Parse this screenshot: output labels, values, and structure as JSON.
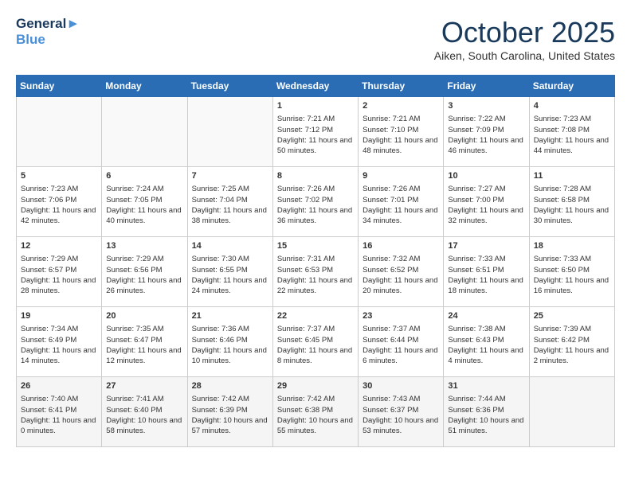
{
  "logo": {
    "line1": "General",
    "line2": "Blue"
  },
  "title": "October 2025",
  "location": "Aiken, South Carolina, United States",
  "days_of_week": [
    "Sunday",
    "Monday",
    "Tuesday",
    "Wednesday",
    "Thursday",
    "Friday",
    "Saturday"
  ],
  "weeks": [
    [
      {
        "day": "",
        "info": ""
      },
      {
        "day": "",
        "info": ""
      },
      {
        "day": "",
        "info": ""
      },
      {
        "day": "1",
        "info": "Sunrise: 7:21 AM\nSunset: 7:12 PM\nDaylight: 11 hours and 50 minutes."
      },
      {
        "day": "2",
        "info": "Sunrise: 7:21 AM\nSunset: 7:10 PM\nDaylight: 11 hours and 48 minutes."
      },
      {
        "day": "3",
        "info": "Sunrise: 7:22 AM\nSunset: 7:09 PM\nDaylight: 11 hours and 46 minutes."
      },
      {
        "day": "4",
        "info": "Sunrise: 7:23 AM\nSunset: 7:08 PM\nDaylight: 11 hours and 44 minutes."
      }
    ],
    [
      {
        "day": "5",
        "info": "Sunrise: 7:23 AM\nSunset: 7:06 PM\nDaylight: 11 hours and 42 minutes."
      },
      {
        "day": "6",
        "info": "Sunrise: 7:24 AM\nSunset: 7:05 PM\nDaylight: 11 hours and 40 minutes."
      },
      {
        "day": "7",
        "info": "Sunrise: 7:25 AM\nSunset: 7:04 PM\nDaylight: 11 hours and 38 minutes."
      },
      {
        "day": "8",
        "info": "Sunrise: 7:26 AM\nSunset: 7:02 PM\nDaylight: 11 hours and 36 minutes."
      },
      {
        "day": "9",
        "info": "Sunrise: 7:26 AM\nSunset: 7:01 PM\nDaylight: 11 hours and 34 minutes."
      },
      {
        "day": "10",
        "info": "Sunrise: 7:27 AM\nSunset: 7:00 PM\nDaylight: 11 hours and 32 minutes."
      },
      {
        "day": "11",
        "info": "Sunrise: 7:28 AM\nSunset: 6:58 PM\nDaylight: 11 hours and 30 minutes."
      }
    ],
    [
      {
        "day": "12",
        "info": "Sunrise: 7:29 AM\nSunset: 6:57 PM\nDaylight: 11 hours and 28 minutes."
      },
      {
        "day": "13",
        "info": "Sunrise: 7:29 AM\nSunset: 6:56 PM\nDaylight: 11 hours and 26 minutes."
      },
      {
        "day": "14",
        "info": "Sunrise: 7:30 AM\nSunset: 6:55 PM\nDaylight: 11 hours and 24 minutes."
      },
      {
        "day": "15",
        "info": "Sunrise: 7:31 AM\nSunset: 6:53 PM\nDaylight: 11 hours and 22 minutes."
      },
      {
        "day": "16",
        "info": "Sunrise: 7:32 AM\nSunset: 6:52 PM\nDaylight: 11 hours and 20 minutes."
      },
      {
        "day": "17",
        "info": "Sunrise: 7:33 AM\nSunset: 6:51 PM\nDaylight: 11 hours and 18 minutes."
      },
      {
        "day": "18",
        "info": "Sunrise: 7:33 AM\nSunset: 6:50 PM\nDaylight: 11 hours and 16 minutes."
      }
    ],
    [
      {
        "day": "19",
        "info": "Sunrise: 7:34 AM\nSunset: 6:49 PM\nDaylight: 11 hours and 14 minutes."
      },
      {
        "day": "20",
        "info": "Sunrise: 7:35 AM\nSunset: 6:47 PM\nDaylight: 11 hours and 12 minutes."
      },
      {
        "day": "21",
        "info": "Sunrise: 7:36 AM\nSunset: 6:46 PM\nDaylight: 11 hours and 10 minutes."
      },
      {
        "day": "22",
        "info": "Sunrise: 7:37 AM\nSunset: 6:45 PM\nDaylight: 11 hours and 8 minutes."
      },
      {
        "day": "23",
        "info": "Sunrise: 7:37 AM\nSunset: 6:44 PM\nDaylight: 11 hours and 6 minutes."
      },
      {
        "day": "24",
        "info": "Sunrise: 7:38 AM\nSunset: 6:43 PM\nDaylight: 11 hours and 4 minutes."
      },
      {
        "day": "25",
        "info": "Sunrise: 7:39 AM\nSunset: 6:42 PM\nDaylight: 11 hours and 2 minutes."
      }
    ],
    [
      {
        "day": "26",
        "info": "Sunrise: 7:40 AM\nSunset: 6:41 PM\nDaylight: 11 hours and 0 minutes."
      },
      {
        "day": "27",
        "info": "Sunrise: 7:41 AM\nSunset: 6:40 PM\nDaylight: 10 hours and 58 minutes."
      },
      {
        "day": "28",
        "info": "Sunrise: 7:42 AM\nSunset: 6:39 PM\nDaylight: 10 hours and 57 minutes."
      },
      {
        "day": "29",
        "info": "Sunrise: 7:42 AM\nSunset: 6:38 PM\nDaylight: 10 hours and 55 minutes."
      },
      {
        "day": "30",
        "info": "Sunrise: 7:43 AM\nSunset: 6:37 PM\nDaylight: 10 hours and 53 minutes."
      },
      {
        "day": "31",
        "info": "Sunrise: 7:44 AM\nSunset: 6:36 PM\nDaylight: 10 hours and 51 minutes."
      },
      {
        "day": "",
        "info": ""
      }
    ]
  ]
}
